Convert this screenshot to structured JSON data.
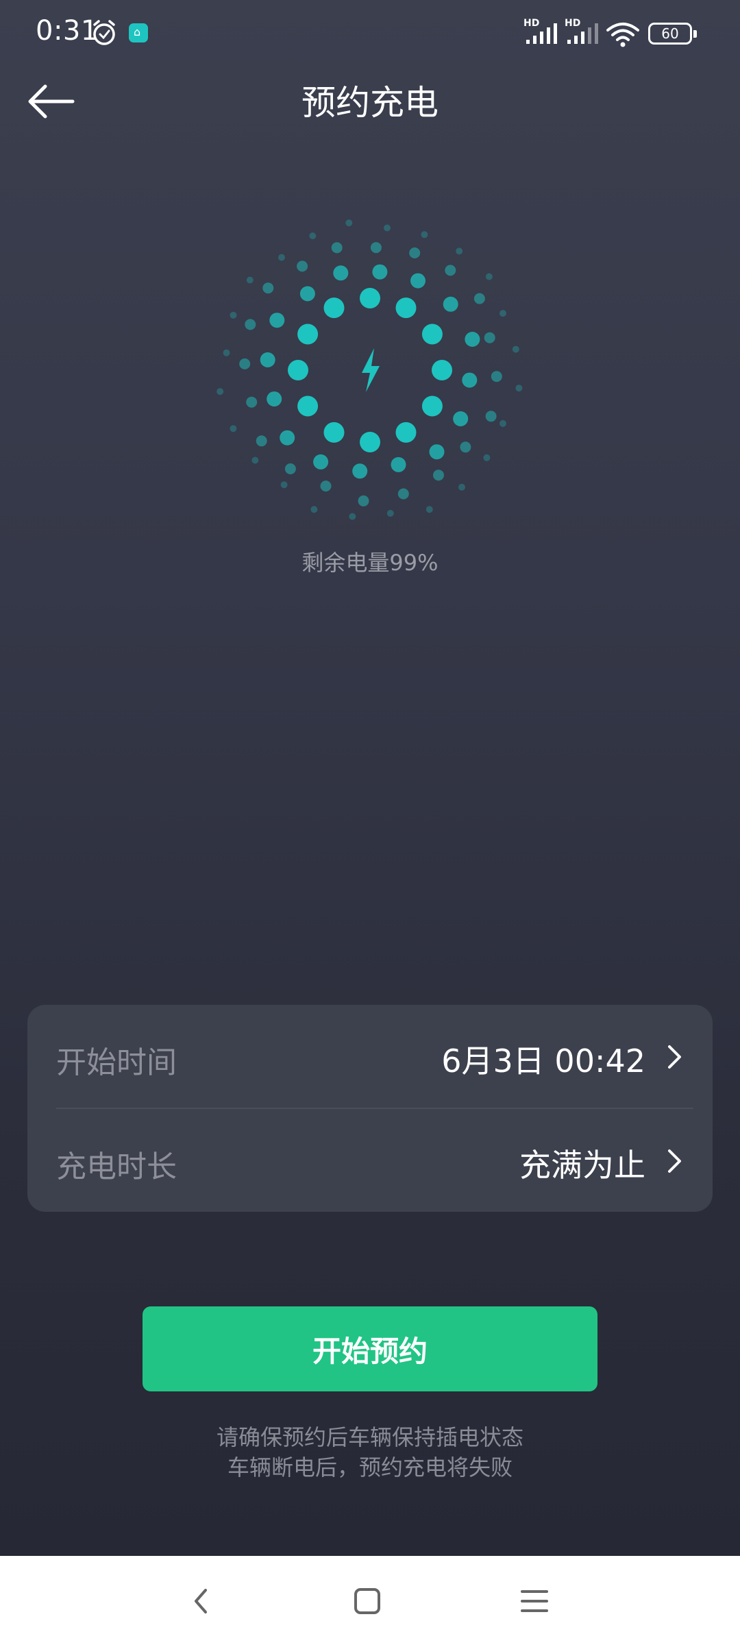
{
  "status_bar": {
    "time": "0:31",
    "signal_1": "HD",
    "signal_2": "HD",
    "battery": "60"
  },
  "header": {
    "title": "预约充电"
  },
  "battery_status": {
    "remaining_label": "剩余电量99%"
  },
  "settings": {
    "start_time": {
      "label": "开始时间",
      "value": "6月3日 00:42"
    },
    "duration": {
      "label": "充电时长",
      "value": "充满为止"
    }
  },
  "action": {
    "start_label": "开始预约"
  },
  "notice": {
    "line1": "请确保预约后车辆保持插电状态",
    "line2": "车辆断电后，预约充电将失败"
  },
  "colors": {
    "accent": "#21c485",
    "orb": "#1ec4c0",
    "card": "#3d404d"
  },
  "icons": [
    "back-arrow-icon",
    "lightning-icon",
    "chevron-right-icon",
    "alarm-icon",
    "wifi-icon",
    "nav-back-icon",
    "nav-home-icon",
    "nav-menu-icon"
  ]
}
